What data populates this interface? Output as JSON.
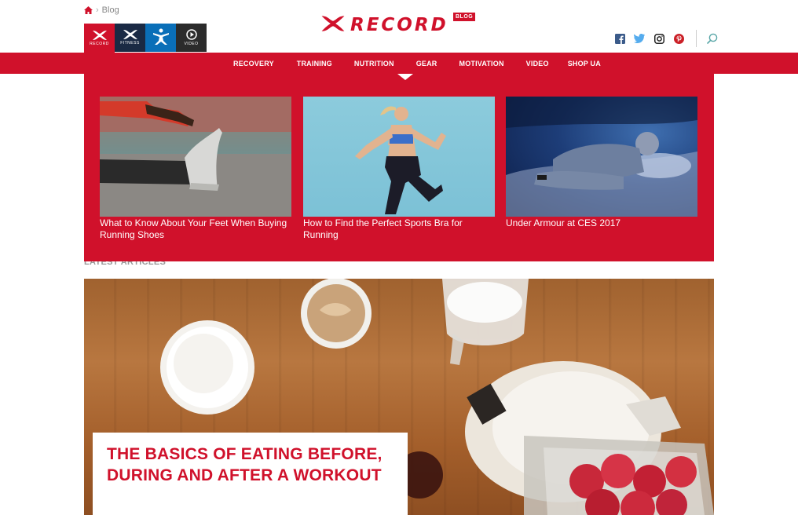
{
  "breadcrumb": {
    "current": "Blog"
  },
  "app_tiles": [
    {
      "label": "RECORD",
      "icon": "ua-logo-icon"
    },
    {
      "label": "FITNESS",
      "icon": "ua-logo-icon"
    },
    {
      "label": "",
      "icon": "mfp-figure-icon"
    },
    {
      "label": "VIDEO",
      "icon": "play-icon"
    }
  ],
  "logo": {
    "word": "RECORD",
    "badge": "BLOG"
  },
  "colors": {
    "brand_red": "#d0112b",
    "nav_text": "#ffffff"
  },
  "nav": {
    "items": [
      "RECOVERY",
      "TRAINING",
      "NUTRITION",
      "GEAR",
      "MOTIVATION",
      "VIDEO",
      "SHOP UA"
    ],
    "active": "GEAR"
  },
  "dropdown": {
    "cards": [
      {
        "caption": "What to Know About Your Feet When Buying Running Shoes"
      },
      {
        "caption": "How to Find the Perfect Sports Bra for Running"
      },
      {
        "caption": "Under Armour at CES 2017"
      }
    ]
  },
  "latest": {
    "label": "LATEST ARTICLES"
  },
  "hero": {
    "title": "THE BASICS OF EATING BEFORE, DURING AND AFTER A WORKOUT"
  }
}
